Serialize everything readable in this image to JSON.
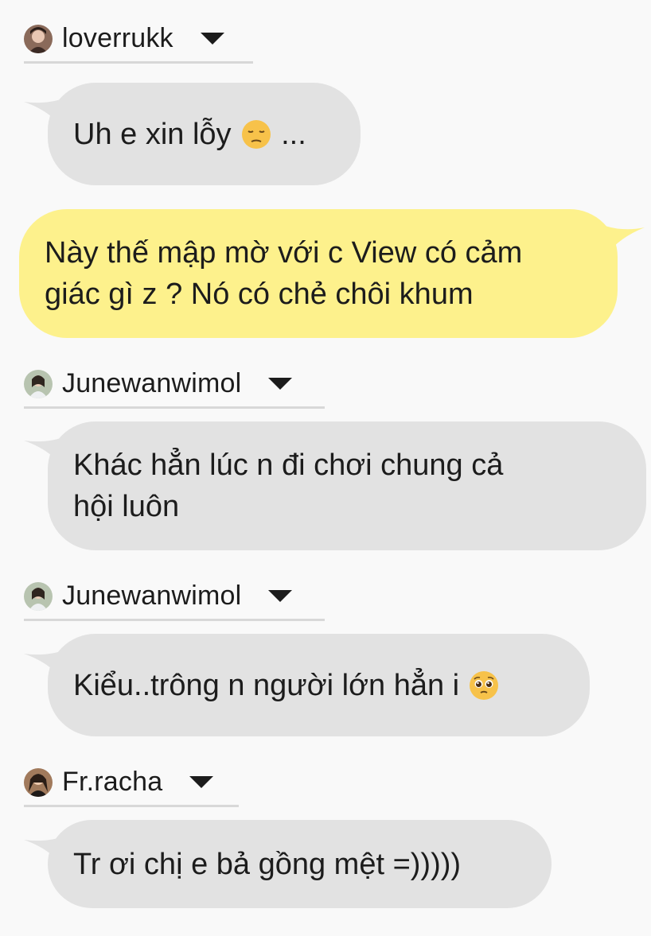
{
  "messages": [
    {
      "sender": "loverrukk",
      "text": "Uh e xin lỗy",
      "emoji": "pensive-face",
      "suffix": " ..."
    },
    {
      "sender": "me",
      "text": "Này thế mập mờ với c View có cảm\ngiác gì z ? Nó có chẻ chôi khum"
    },
    {
      "sender": "Junewanwimol",
      "text": "Khác hẳn lúc n đi chơi chung cả\nhội luôn"
    },
    {
      "sender": "Junewanwimol",
      "text": "Kiểu..trông n người lớn hẳn i",
      "emoji": "pleading-face"
    },
    {
      "sender": "Fr.racha",
      "text": "Tr ơi chị e bả gồng mệt =)))))"
    }
  ],
  "icons": {
    "sender_menu": "chevron-down-icon",
    "avatar": "avatar"
  },
  "colors": {
    "incoming_bubble": "#e2e2e2",
    "outgoing_bubble": "#fdf18c",
    "background": "#f9f9f9"
  }
}
